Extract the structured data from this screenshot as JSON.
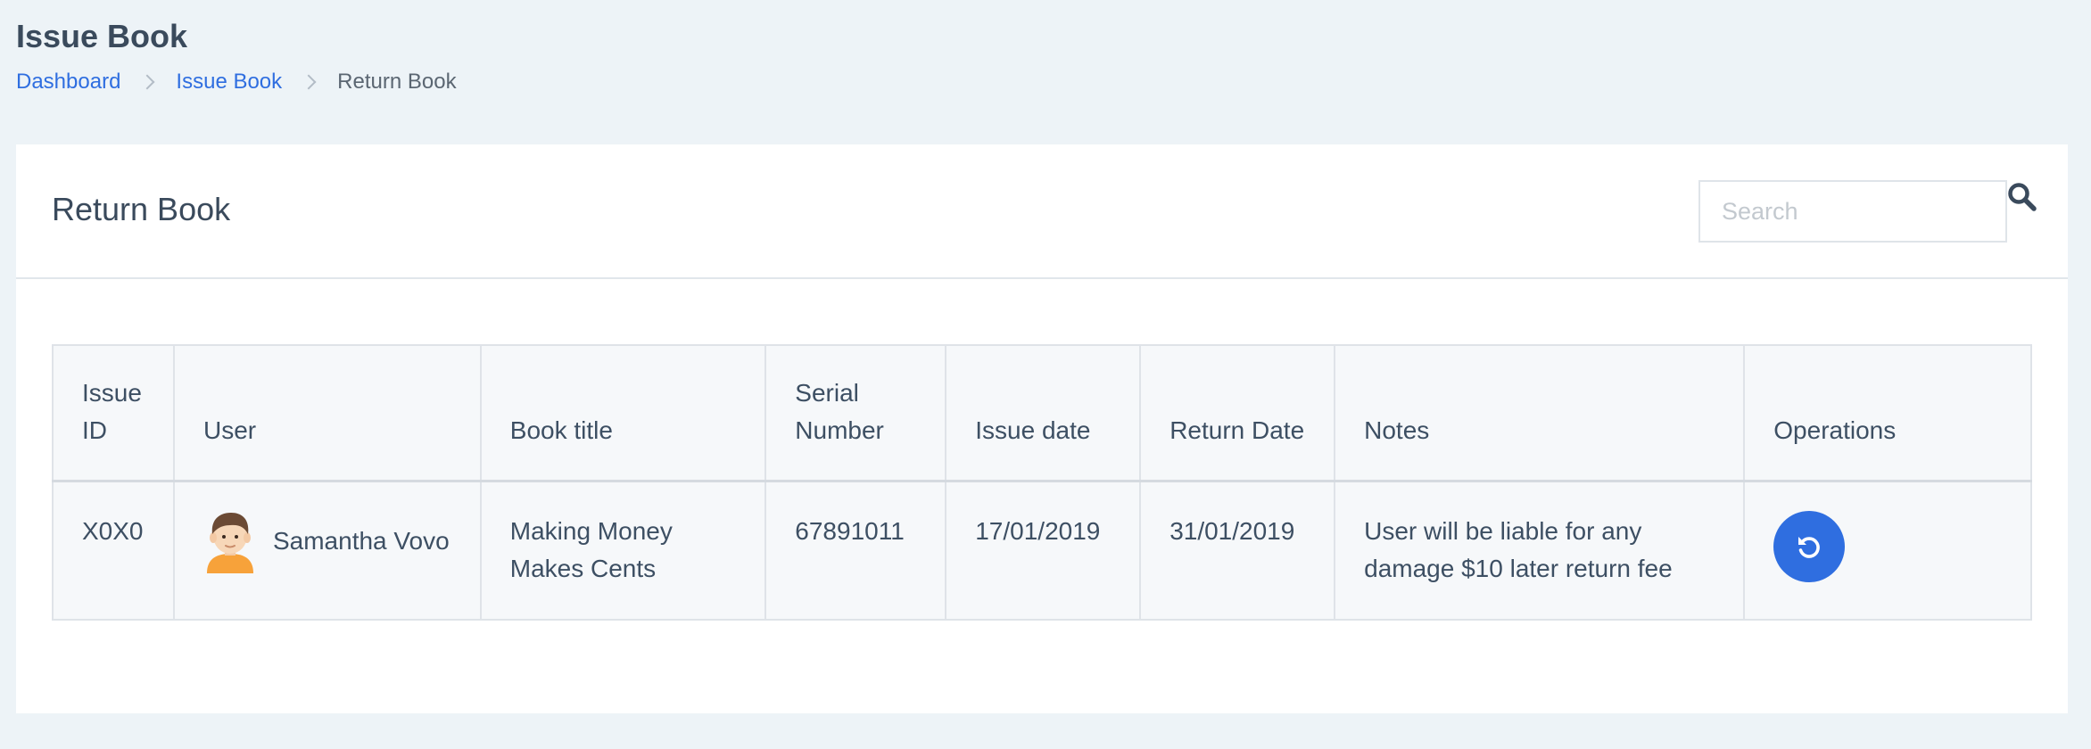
{
  "header": {
    "title": "Issue Book",
    "breadcrumb": [
      "Dashboard",
      "Issue Book",
      "Return Book"
    ]
  },
  "card": {
    "title": "Return Book",
    "search": {
      "placeholder": "Search",
      "value": ""
    }
  },
  "table": {
    "columns": {
      "issue_id": "Issue ID",
      "user": "User",
      "book_title": "Book title",
      "serial_number": "Serial Number",
      "issue_date": "Issue date",
      "return_date": "Return Date",
      "notes": "Notes",
      "operations": "Operations"
    },
    "rows": [
      {
        "issue_id": "X0X0",
        "user": "Samantha Vovo",
        "book_title": "Making Money Makes Cents",
        "serial_number": "67891011",
        "issue_date": "17/01/2019",
        "return_date": "31/01/2019",
        "notes": "User will be liable for any damage $10 later return fee",
        "operation_icon": "undo-icon"
      }
    ]
  },
  "colors": {
    "accent": "#2f6ee0",
    "background": "#edf3f7",
    "text": "#3d4f63"
  }
}
